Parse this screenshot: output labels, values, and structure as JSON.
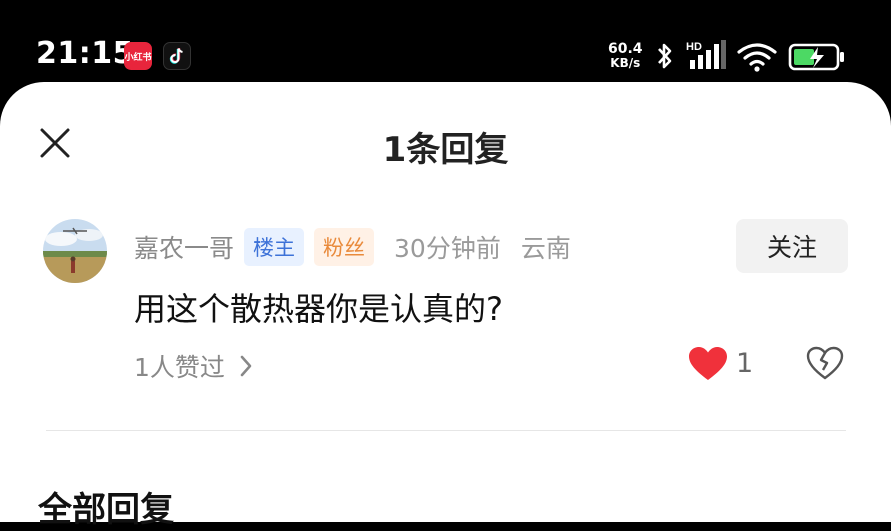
{
  "status_bar": {
    "time": "21:15",
    "app_badge_text": "小红书",
    "net_speed_value": "60.4",
    "net_speed_unit": "KB/s",
    "signal_label": "HD",
    "icons": [
      "xiaohongshu-app-icon",
      "tiktok-app-icon",
      "bluetooth-icon",
      "cellular-signal-icon",
      "wifi-icon",
      "battery-charging-icon"
    ]
  },
  "sheet": {
    "title": "1条回复",
    "close_icon": "close-icon"
  },
  "reply": {
    "author": "嘉农一哥",
    "tags": {
      "owner": "楼主",
      "fan": "粉丝"
    },
    "time": "30分钟前",
    "location": "云南",
    "follow_label": "关注",
    "text": "用这个散热器你是认真的?",
    "likes_summary": "1人赞过",
    "like_count": "1",
    "colors": {
      "like": "#f0313b",
      "owner_tag": "#3d72d8",
      "fan_tag": "#e98a3b"
    }
  },
  "section": {
    "title": "全部回复"
  }
}
